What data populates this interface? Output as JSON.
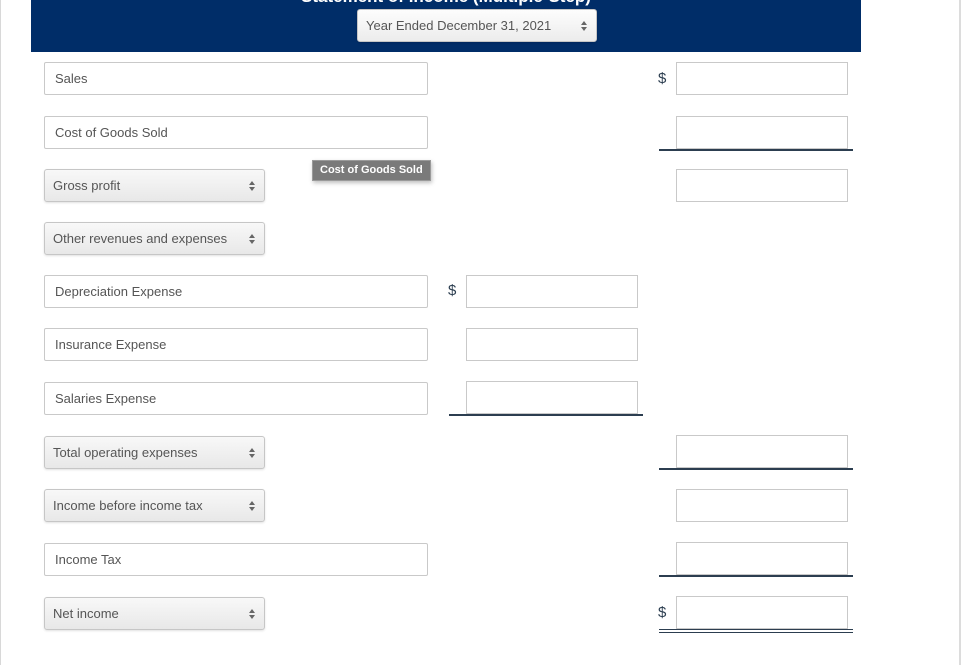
{
  "header": {
    "title": "Statement of Income (Multiple-Step)",
    "title_note": "title is clipped at the top edge of the screenshot; wording inferred from partially visible glyphs",
    "period_select": "Year Ended December 31, 2021",
    "background_color": "#002d68"
  },
  "tooltip": {
    "text": "Cost of Goods Sold"
  },
  "currency_symbol": "$",
  "rows": [
    {
      "label": "Sales",
      "type": "text"
    },
    {
      "label": "Cost of Goods Sold",
      "type": "text"
    },
    {
      "label": "Gross profit",
      "type": "select"
    },
    {
      "label": "Other revenues and expenses",
      "type": "select"
    },
    {
      "label": "Depreciation Expense",
      "type": "text"
    },
    {
      "label": "Insurance Expense",
      "type": "text"
    },
    {
      "label": "Salaries Expense",
      "type": "text"
    },
    {
      "label": "Total operating expenses",
      "type": "select"
    },
    {
      "label": "Income before income tax",
      "type": "select"
    },
    {
      "label": "Income Tax",
      "type": "text"
    },
    {
      "label": "Net income",
      "type": "select"
    }
  ],
  "amounts": {
    "sales": "",
    "cost_of_goods_sold": "",
    "gross_profit": "",
    "depreciation_expense": "",
    "insurance_expense": "",
    "salaries_expense": "",
    "total_operating_expenses": "",
    "income_before_income_tax": "",
    "income_tax": "",
    "net_income": ""
  }
}
